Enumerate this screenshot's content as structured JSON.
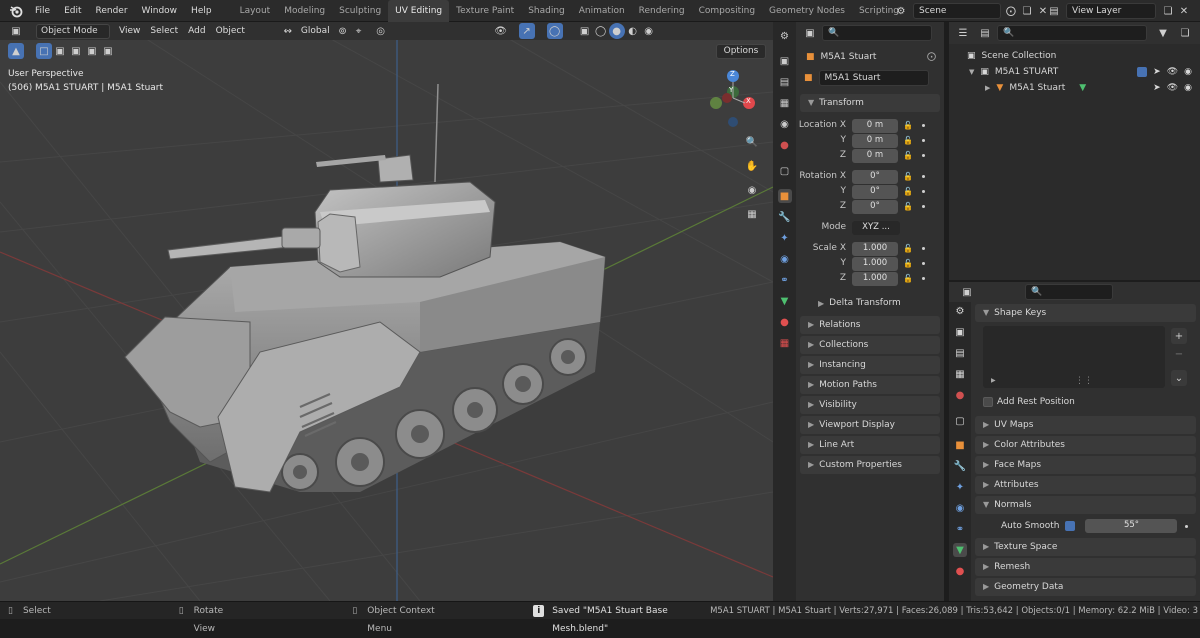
{
  "topbar": {
    "menus": [
      "File",
      "Edit",
      "Render",
      "Window",
      "Help"
    ],
    "workspaces": [
      "Layout",
      "Modeling",
      "Sculpting",
      "UV Editing",
      "Texture Paint",
      "Shading",
      "Animation",
      "Rendering",
      "Compositing",
      "Geometry Nodes",
      "Scripting"
    ],
    "active_workspace": "UV Editing",
    "add_tab": "+",
    "scene": "Scene",
    "view_layer": "View Layer"
  },
  "viewport": {
    "mode": "Object Mode",
    "menus": [
      "View",
      "Select",
      "Add",
      "Object"
    ],
    "orientation": "Global",
    "options": "Options",
    "overlay_line1": "User Perspective",
    "overlay_line2": "(506) M5A1 STUART | M5A1 Stuart",
    "gizmo": {
      "x": "X",
      "y": "Y",
      "z": "Z"
    }
  },
  "properties": {
    "object_name": "M5A1 Stuart",
    "object_field": "M5A1 Stuart",
    "transform": "Transform",
    "location": {
      "label": "Location X",
      "x": "0 m",
      "y": "0 m",
      "z": "0 m"
    },
    "rotation": {
      "label": "Rotation X",
      "x": "0°",
      "y": "0°",
      "z": "0°"
    },
    "axis_y": "Y",
    "axis_z": "Z",
    "mode_label": "Mode",
    "mode_value": "XYZ ...",
    "scale": {
      "label": "Scale X",
      "x": "1.000",
      "y": "1.000",
      "z": "1.000"
    },
    "delta": "Delta Transform",
    "panels": [
      "Relations",
      "Collections",
      "Instancing",
      "Motion Paths",
      "Visibility",
      "Viewport Display",
      "Line Art",
      "Custom Properties"
    ]
  },
  "outliner": {
    "collection": "Scene Collection",
    "parent": "M5A1 STUART",
    "child": "M5A1 Stuart"
  },
  "mesh_props": {
    "shape_keys": "Shape Keys",
    "add_rest": "Add Rest Position",
    "panels": [
      "UV Maps",
      "Color Attributes",
      "Face Maps",
      "Attributes"
    ],
    "normals": "Normals",
    "auto_smooth": "Auto Smooth",
    "angle": "55°",
    "panels2": [
      "Texture Space",
      "Remesh",
      "Geometry Data"
    ]
  },
  "statusbar": {
    "select": "Select",
    "rotate": "Rotate View",
    "context": "Object Context Menu",
    "saved": "Saved \"M5A1 Stuart Base Mesh.blend\"",
    "stats": "M5A1 STUART | M5A1 Stuart | Verts:27,971 | Faces:26,089 | Tris:53,642 | Objects:0/1 | Memory: 62.2 MiB | Video: 3"
  },
  "colors": {
    "accent": "#4772b3",
    "active_blue": "#4772b3",
    "axis_x": "#e0484c",
    "axis_y": "#82c845",
    "axis_z": "#4a87d8",
    "mesh": "#8b8b8b"
  }
}
